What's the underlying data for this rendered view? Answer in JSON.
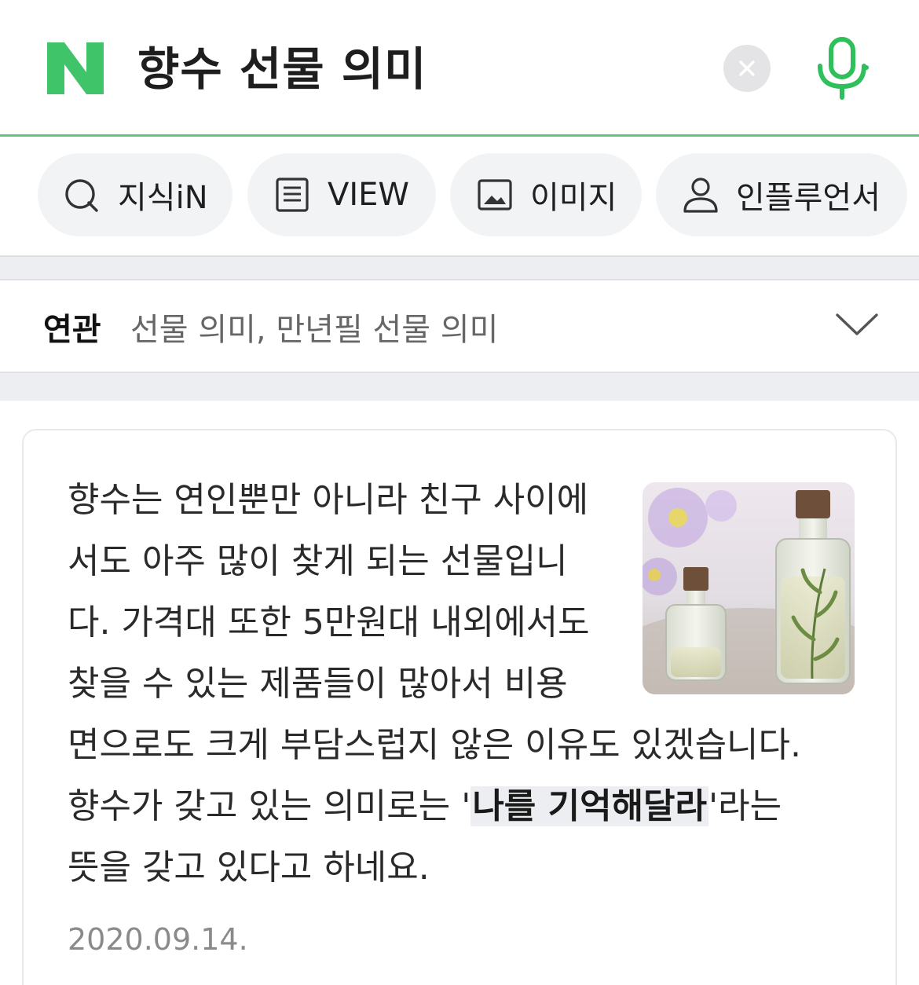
{
  "search": {
    "logo_letter": "N",
    "query": "향수 선물 의미",
    "brand_color": "#03c75a"
  },
  "tabs": [
    {
      "label": "지식iN",
      "icon": "search-icon"
    },
    {
      "label": "VIEW",
      "icon": "document-icon"
    },
    {
      "label": "이미지",
      "icon": "image-icon"
    },
    {
      "label": "인플루언서",
      "icon": "person-icon"
    }
  ],
  "related": {
    "label": "연관",
    "terms": "선물 의미, 만년필 선물 의미"
  },
  "card": {
    "lines": [
      "향수는 연인뿐만 아니라 친구 사이에",
      "서도 아주 많이 찾게 되는 선물입니",
      "다. 가격대 또한 5만원대 내외에서도",
      "찾을 수 있는 제품들이 많아서 비용",
      "면으로도 크게 부담스럽지 않은 이유도 있겠습니다."
    ],
    "line6_before": "향수가 갖고 있는 의미로는 '",
    "line6_highlight": "나를 기억해달라",
    "line6_after": "'라는",
    "line7": "뜻을 갖고 있다고 하네요.",
    "date": "2020.09.14."
  }
}
